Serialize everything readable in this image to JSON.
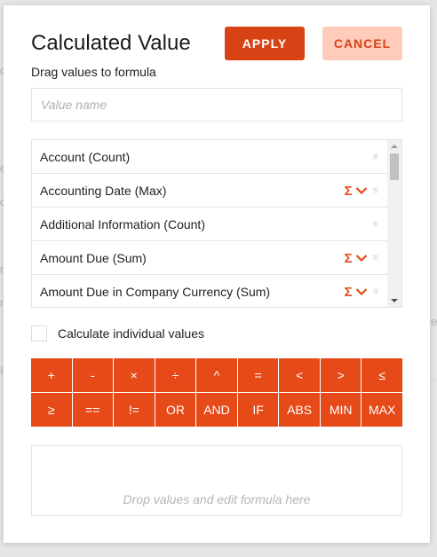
{
  "dialog": {
    "title": "Calculated Value",
    "subtitle": "Drag values to formula",
    "apply_label": "APPLY",
    "cancel_label": "CANCEL",
    "value_name_placeholder": "Value name",
    "checkbox_label": "Calculate individual values",
    "checkbox_checked": false,
    "formula_placeholder": "Drop values and edit formula here"
  },
  "fields": [
    {
      "label": "Account (Count)",
      "aggregation_menu": false
    },
    {
      "label": "Accounting Date (Max)",
      "aggregation_menu": true
    },
    {
      "label": "Additional Information (Count)",
      "aggregation_menu": false
    },
    {
      "label": "Amount Due (Sum)",
      "aggregation_menu": true
    },
    {
      "label": "Amount Due in Company Currency (Sum)",
      "aggregation_menu": true
    }
  ],
  "operators": [
    "+",
    "-",
    "×",
    "÷",
    "^",
    "=",
    "<",
    ">",
    "≤",
    "≥",
    "==",
    "!=",
    "OR",
    "AND",
    "IF",
    "ABS",
    "MIN",
    "MAX"
  ],
  "icons": {
    "sigma": "Σ",
    "drag": "≡"
  },
  "colors": {
    "accent": "#e64a19",
    "apply_bg": "#d84315",
    "cancel_bg": "#ffccbc"
  }
}
